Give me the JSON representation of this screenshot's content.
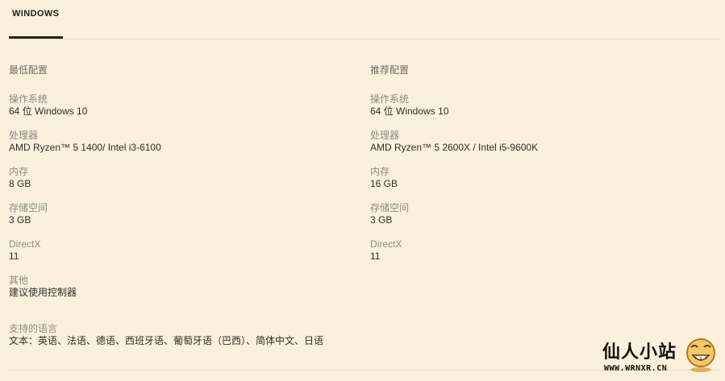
{
  "tabs": [
    {
      "label": "WINDOWS",
      "active": true
    }
  ],
  "minimum": {
    "title": "最低配置",
    "specs": [
      {
        "label": "操作系统",
        "value": "64 位 Windows 10"
      },
      {
        "label": "处理器",
        "value": "AMD Ryzen™ 5 1400/ Intel i3-6100"
      },
      {
        "label": "内存",
        "value": "8 GB"
      },
      {
        "label": "存储空间",
        "value": "3 GB"
      },
      {
        "label": "DirectX",
        "value": "11"
      },
      {
        "label": "其他",
        "value": "建议使用控制器"
      }
    ]
  },
  "recommended": {
    "title": "推荐配置",
    "specs": [
      {
        "label": "操作系统",
        "value": "64 位 Windows 10"
      },
      {
        "label": "处理器",
        "value": "AMD Ryzen™ 5 2600X / Intel i5-9600K"
      },
      {
        "label": "内存",
        "value": "16 GB"
      },
      {
        "label": "存储空间",
        "value": "3 GB"
      },
      {
        "label": "DirectX",
        "value": "11"
      }
    ]
  },
  "languages": {
    "label": "支持的语言",
    "value": "文本：英语、法语、德语、西班牙语、葡萄牙语（巴西）、简体中文、日语"
  },
  "watermark": {
    "title": "仙人小站",
    "url": "WWW.WRNXR.CN",
    "icon": "smiley-face-icon"
  },
  "colors": {
    "background": "#fbf0db",
    "tab_underline": "#202020",
    "divider": "#e6dcc6"
  }
}
